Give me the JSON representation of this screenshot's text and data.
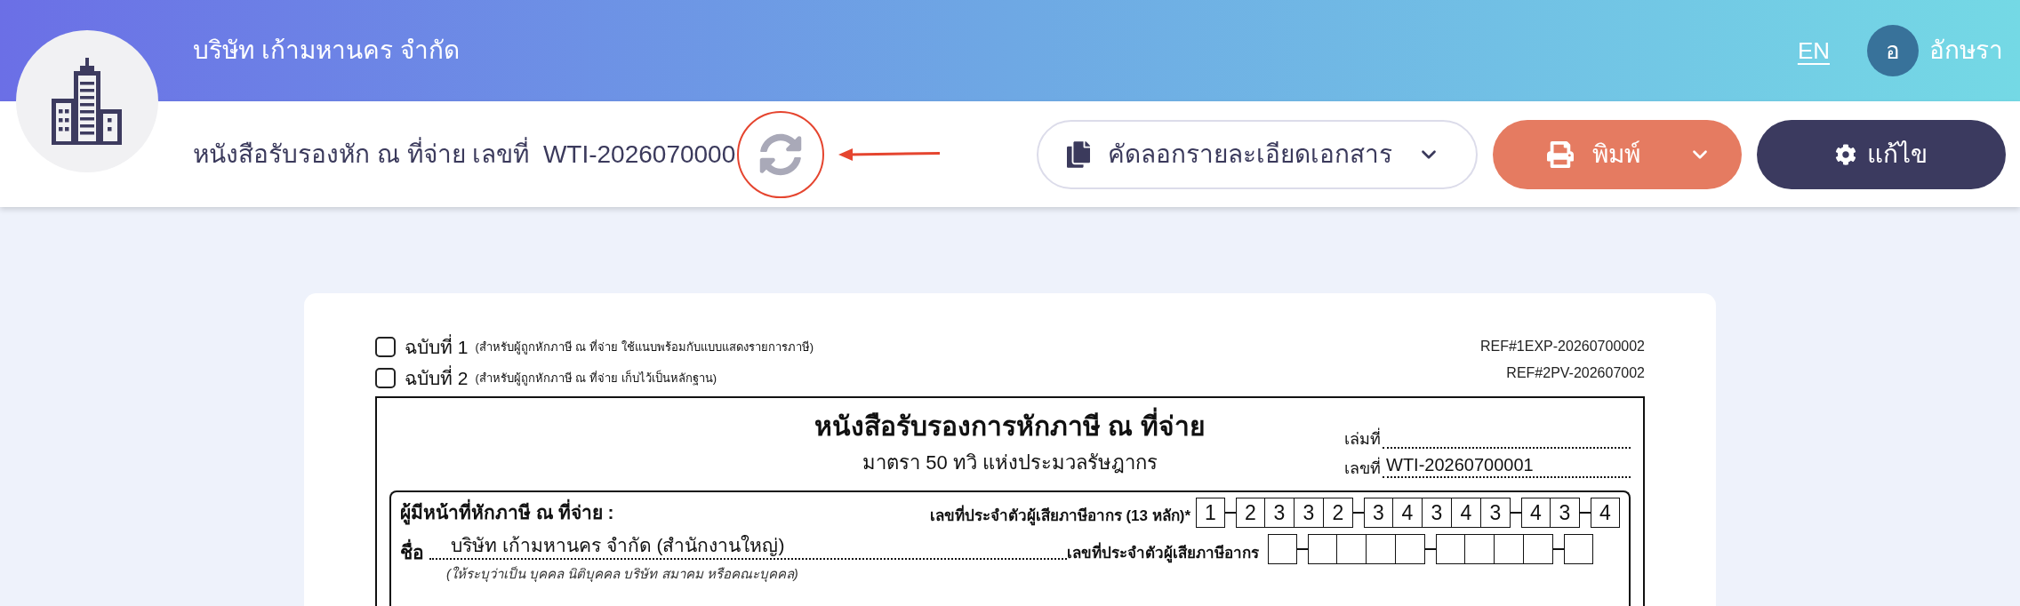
{
  "header": {
    "company_name": "บริษัท เก้ามหานคร จำกัด",
    "language_link": "EN",
    "user": {
      "initial": "อ",
      "name": "อักษรา"
    }
  },
  "toolbar": {
    "title": "หนังสือรับรองหัก ณ ที่จ่าย เลขที่  WTI-2026070000",
    "buttons": [
      {
        "kind": "copy",
        "label": "คัดลอกรายละเอียดเอกสาร",
        "dropdown": true
      },
      {
        "kind": "print",
        "label": "พิมพ์",
        "dropdown": true
      },
      {
        "kind": "edit",
        "label": "แก้ไข",
        "dropdown": false
      }
    ]
  },
  "document": {
    "copies": [
      {
        "label": "ฉบับที่ 1",
        "note": "(สำหรับผู้ถูกหักภาษี ณ ที่จ่าย ใช้แนบพร้อมกับแบบแสดงรายการภาษี)",
        "checked": false
      },
      {
        "label": "ฉบับที่ 2",
        "note": "(สำหรับผู้ถูกหักภาษี ณ ที่จ่าย เก็บไว้เป็นหลักฐาน)",
        "checked": false
      }
    ],
    "refs": [
      "REF#1EXP-20260700002",
      "REF#2PV-202607002"
    ],
    "title": "หนังสือรับรองการหักภาษี ณ ที่จ่าย",
    "subtitle": "มาตรา 50 ทวิ แห่งประมวลรัษฎากร",
    "numbers": [
      {
        "label": "เล่มที่"
      },
      {
        "label": "เลขที่",
        "value": "WTI-20260700001"
      }
    ],
    "payer": {
      "heading": "ผู้มีหน้าที่หักภาษี ณ ที่จ่าย :",
      "tax_id_label": "เลขที่ประจำตัวผู้เสียภาษีอากร (13 หลัก)*",
      "tax_id_digits": [
        [
          "1"
        ],
        [
          "2",
          "3",
          "3",
          "2"
        ],
        [
          "3",
          "4",
          "3",
          "4",
          "3"
        ],
        [
          "4",
          "3"
        ],
        [
          "4"
        ]
      ],
      "name_label": "ชื่อ",
      "name": "บริษัท เก้ามหานคร จำกัด (สำนักงานใหญ่)",
      "name_hint": "(ให้ระบุว่าเป็น บุคคล นิติบุคคล บริษัท สมาคม หรือคณะบุคคล)",
      "tax_number_label": "เลขที่ประจำตัวผู้เสียภาษีอากร"
    }
  }
}
